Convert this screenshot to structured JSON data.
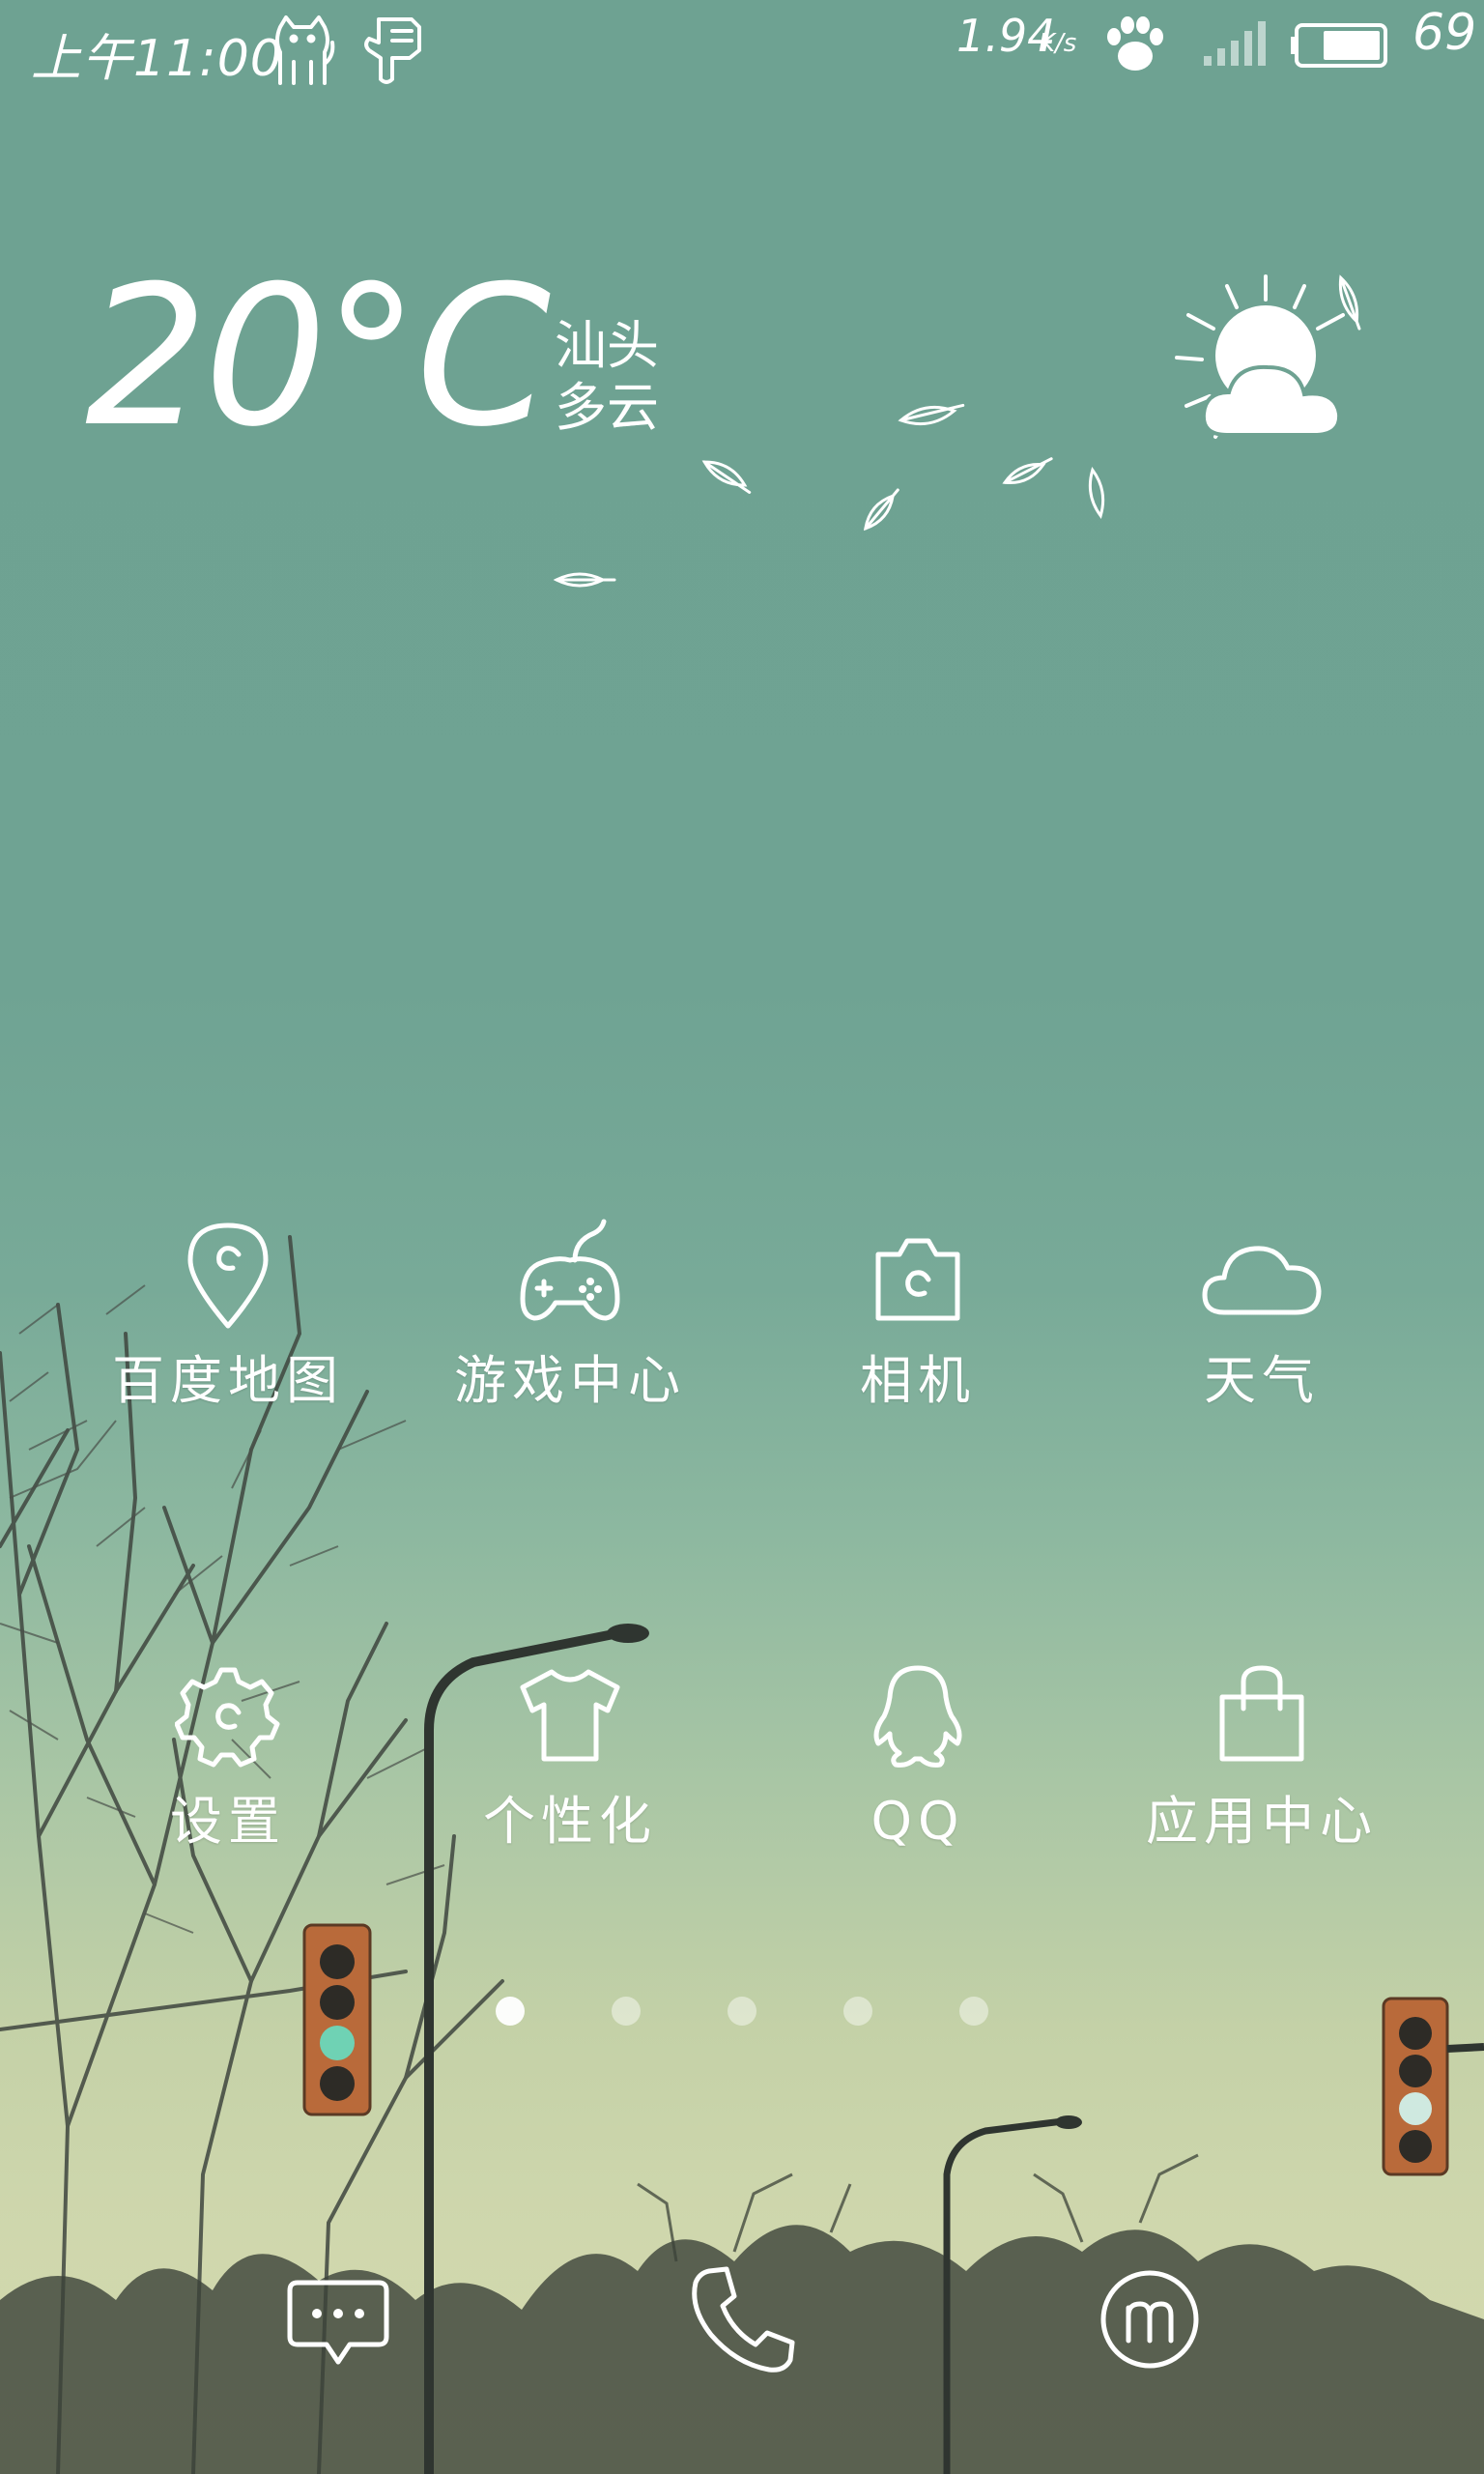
{
  "status_bar": {
    "time": "上午11:00",
    "net_speed": "1.94",
    "net_speed_unit": "K/s",
    "battery_percent": "69",
    "icons": [
      "cat-icon",
      "pointing-hand-icon",
      "paw-icon",
      "signal-icon",
      "battery-icon"
    ]
  },
  "weather": {
    "temperature": "20°C",
    "city": "汕头",
    "condition": "多云",
    "icon": "partly-cloudy-icon"
  },
  "apps": [
    {
      "label": "百度地图",
      "icon": "map-pin-icon"
    },
    {
      "label": "游戏中心",
      "icon": "gamepad-icon"
    },
    {
      "label": "相机",
      "icon": "camera-icon"
    },
    {
      "label": "天气",
      "icon": "cloud-icon"
    },
    {
      "label": "设置",
      "icon": "gear-icon"
    },
    {
      "label": "个性化",
      "icon": "tshirt-icon"
    },
    {
      "label": "QQ",
      "icon": "qq-penguin-icon"
    },
    {
      "label": "应用中心",
      "icon": "shopping-bag-icon"
    }
  ],
  "pager": {
    "page_count": 5,
    "active_page": 1
  },
  "dock": [
    {
      "icon": "messages-icon"
    },
    {
      "icon": "phone-icon"
    },
    {
      "icon": "browser-m-icon"
    }
  ]
}
